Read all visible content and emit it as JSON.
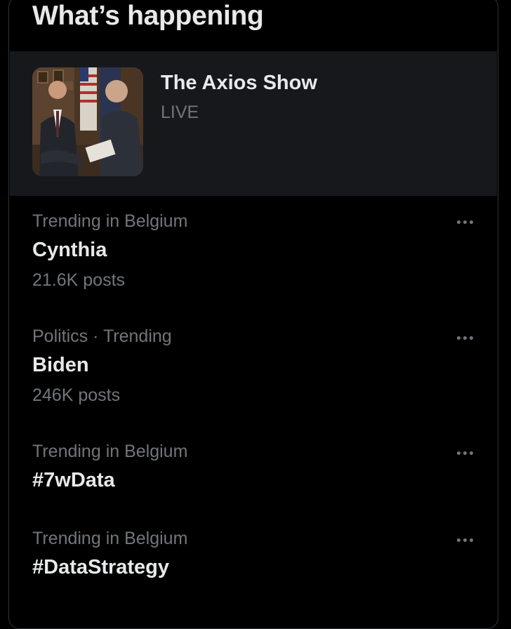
{
  "colors": {
    "background": "#000000",
    "card_background": "#16181c",
    "primary_text": "#e7e9ea",
    "secondary_text": "#71767b",
    "border": "#2f3336"
  },
  "header": {
    "title": "What’s happening"
  },
  "live_event": {
    "title": "The Axios Show",
    "status": "LIVE",
    "thumbnail_icon": "video-thumbnail"
  },
  "trends": [
    {
      "context": "Trending in Belgium",
      "name": "Cynthia",
      "post_count": "21.6K posts",
      "more_icon": "more-horizontal-icon"
    },
    {
      "context": "Politics · Trending",
      "name": "Biden",
      "post_count": "246K posts",
      "more_icon": "more-horizontal-icon"
    },
    {
      "context": "Trending in Belgium",
      "name": "#7wData",
      "post_count": "",
      "more_icon": "more-horizontal-icon"
    },
    {
      "context": "Trending in Belgium",
      "name": "#DataStrategy",
      "post_count": "",
      "more_icon": "more-horizontal-icon"
    }
  ]
}
